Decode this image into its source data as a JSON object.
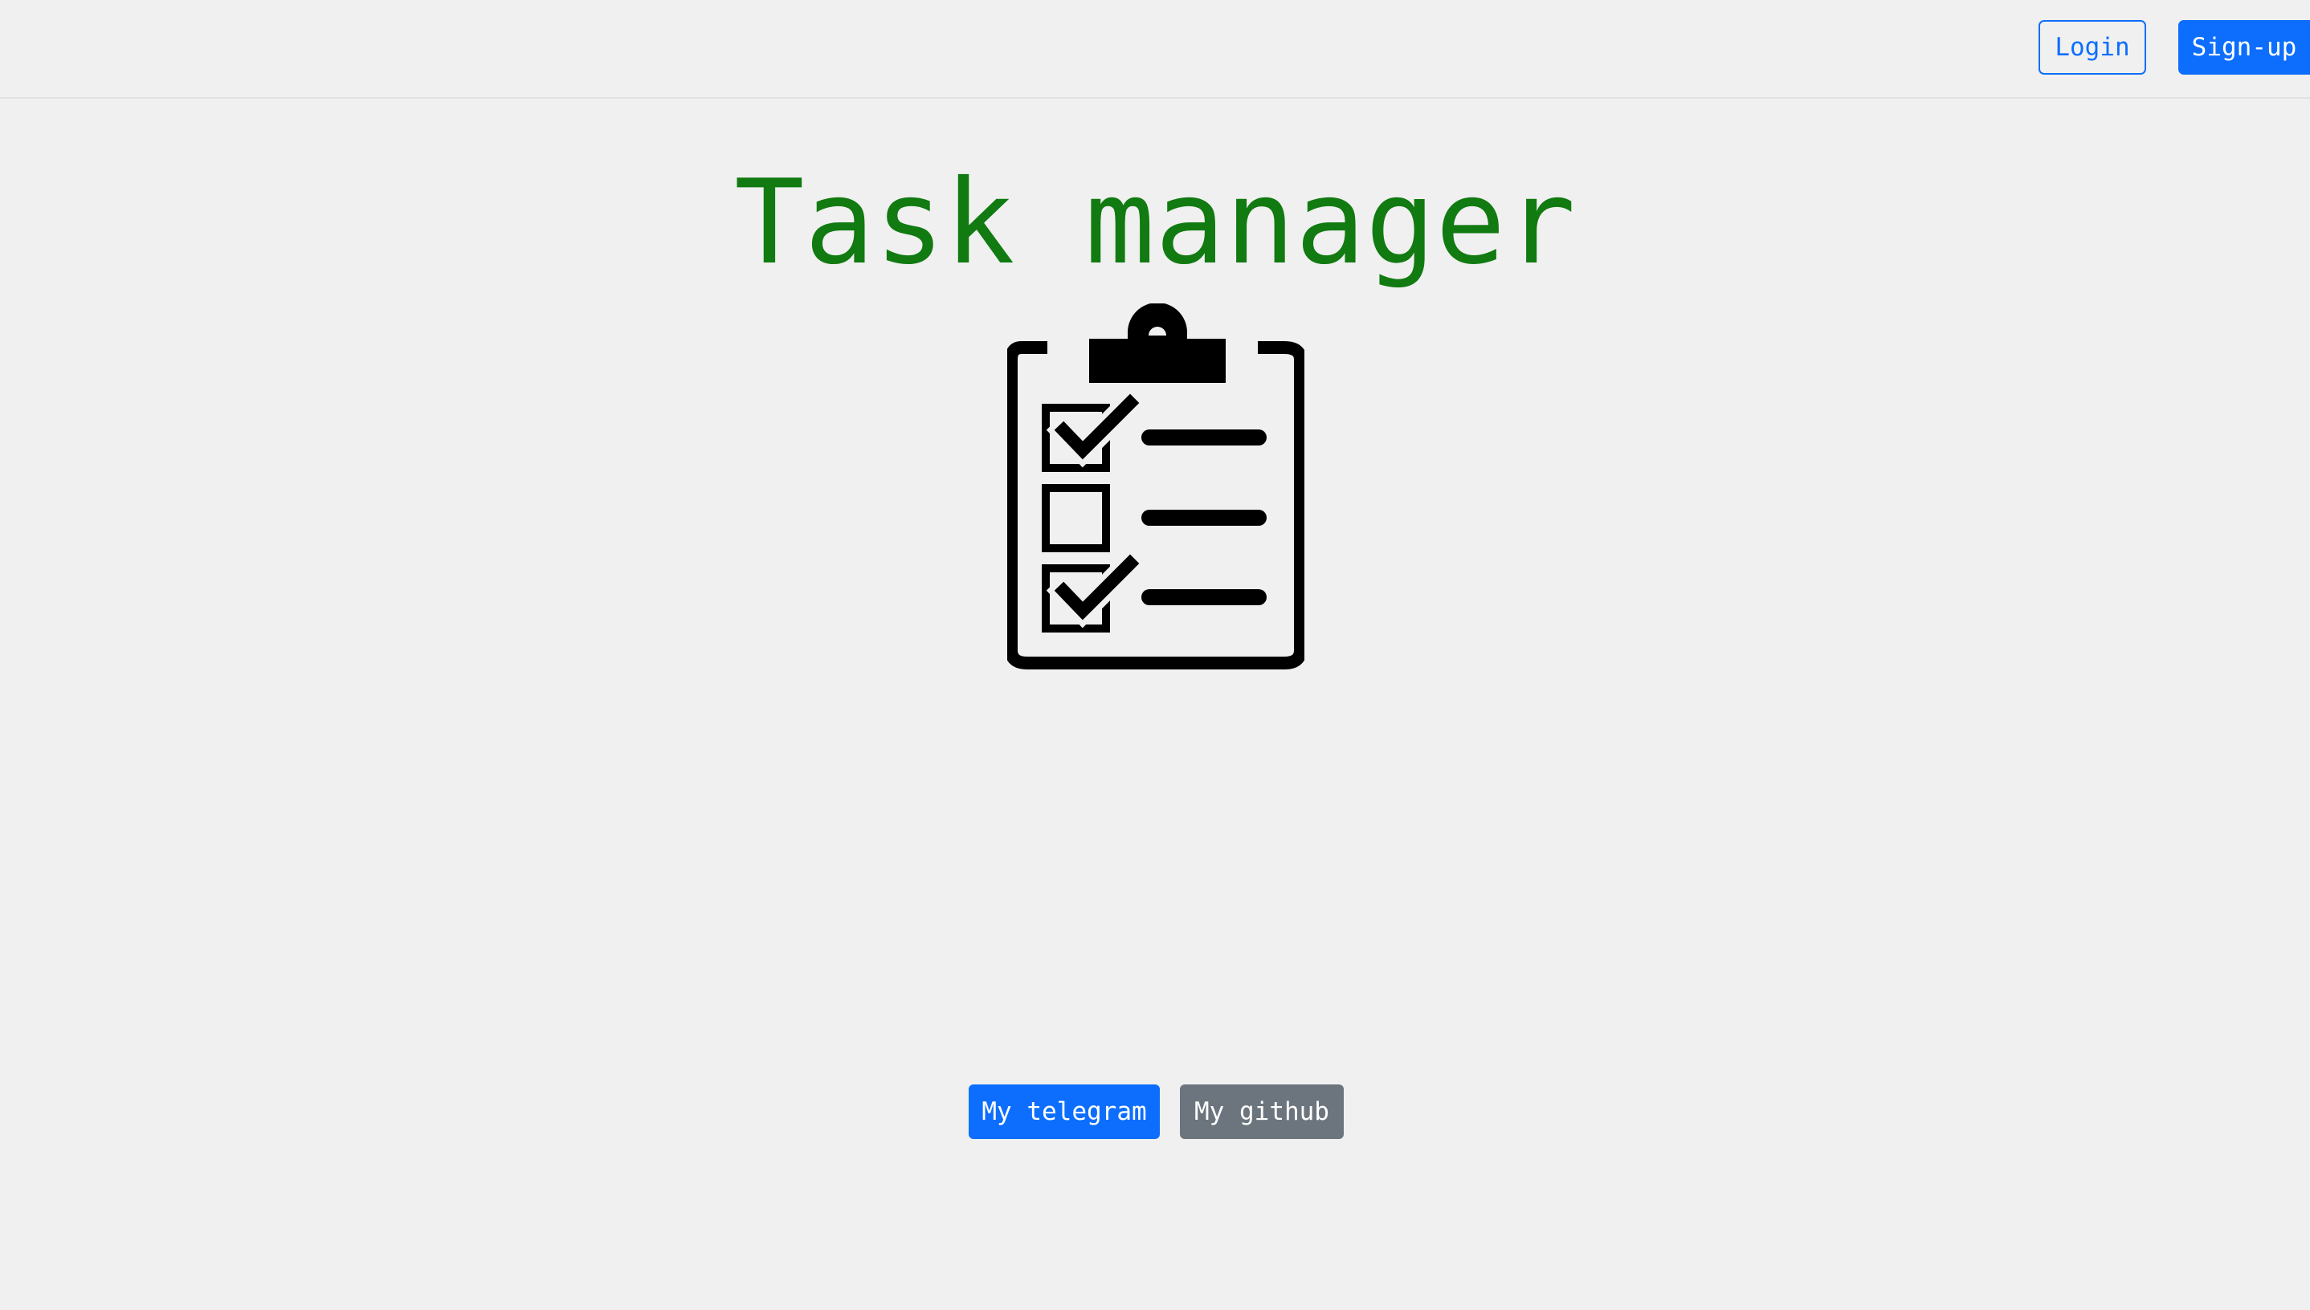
{
  "header": {
    "login_label": "Login",
    "signup_label": "Sign-up"
  },
  "main": {
    "title": "Task manager",
    "icon": "clipboard-checklist-icon"
  },
  "footer": {
    "telegram_label": "My telegram",
    "github_label": "My github"
  },
  "colors": {
    "background": "#f0f0f0",
    "title": "#117a11",
    "primary": "#0d6efd",
    "secondary": "#6c757d"
  }
}
